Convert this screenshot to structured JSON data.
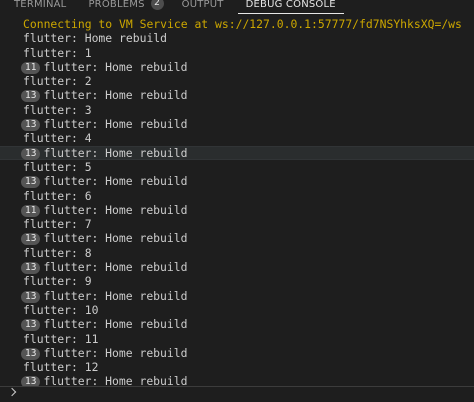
{
  "tabs": [
    {
      "label": "TERMINAL",
      "active": false
    },
    {
      "label": "PROBLEMS",
      "active": false,
      "badge": "2"
    },
    {
      "label": "OUTPUT",
      "active": false
    },
    {
      "label": "DEBUG CONSOLE",
      "active": true
    }
  ],
  "console": {
    "lines": [
      {
        "text": "Connecting to VM Service at ws://127.0.0.1:57777/fd7NSYhksXQ=/ws",
        "kind": "warn"
      },
      {
        "text": "flutter: Home rebuild"
      },
      {
        "text": "flutter: 1"
      },
      {
        "count": "11",
        "text": "flutter: Home rebuild"
      },
      {
        "text": "flutter: 2"
      },
      {
        "count": "13",
        "text": "flutter: Home rebuild"
      },
      {
        "text": "flutter: 3"
      },
      {
        "count": "13",
        "text": "flutter: Home rebuild"
      },
      {
        "text": "flutter: 4"
      },
      {
        "count": "13",
        "text": "flutter: Home rebuild",
        "highlight": true
      },
      {
        "text": "flutter: 5"
      },
      {
        "count": "13",
        "text": "flutter: Home rebuild"
      },
      {
        "text": "flutter: 6"
      },
      {
        "count": "11",
        "text": "flutter: Home rebuild"
      },
      {
        "text": "flutter: 7"
      },
      {
        "count": "13",
        "text": "flutter: Home rebuild"
      },
      {
        "text": "flutter: 8"
      },
      {
        "count": "13",
        "text": "flutter: Home rebuild"
      },
      {
        "text": "flutter: 9"
      },
      {
        "count": "13",
        "text": "flutter: Home rebuild"
      },
      {
        "text": "flutter: 10"
      },
      {
        "count": "13",
        "text": "flutter: Home rebuild"
      },
      {
        "text": "flutter: 11"
      },
      {
        "count": "13",
        "text": "flutter: Home rebuild"
      },
      {
        "text": "flutter: 12"
      },
      {
        "count": "13",
        "text": "flutter: Home rebuild"
      }
    ]
  },
  "input": {
    "prompt_icon": "chevron-right-icon"
  },
  "colors": {
    "background": "#1e1e1e",
    "warning_text": "#cca700",
    "text": "#cccccc",
    "badge": "#555555"
  }
}
